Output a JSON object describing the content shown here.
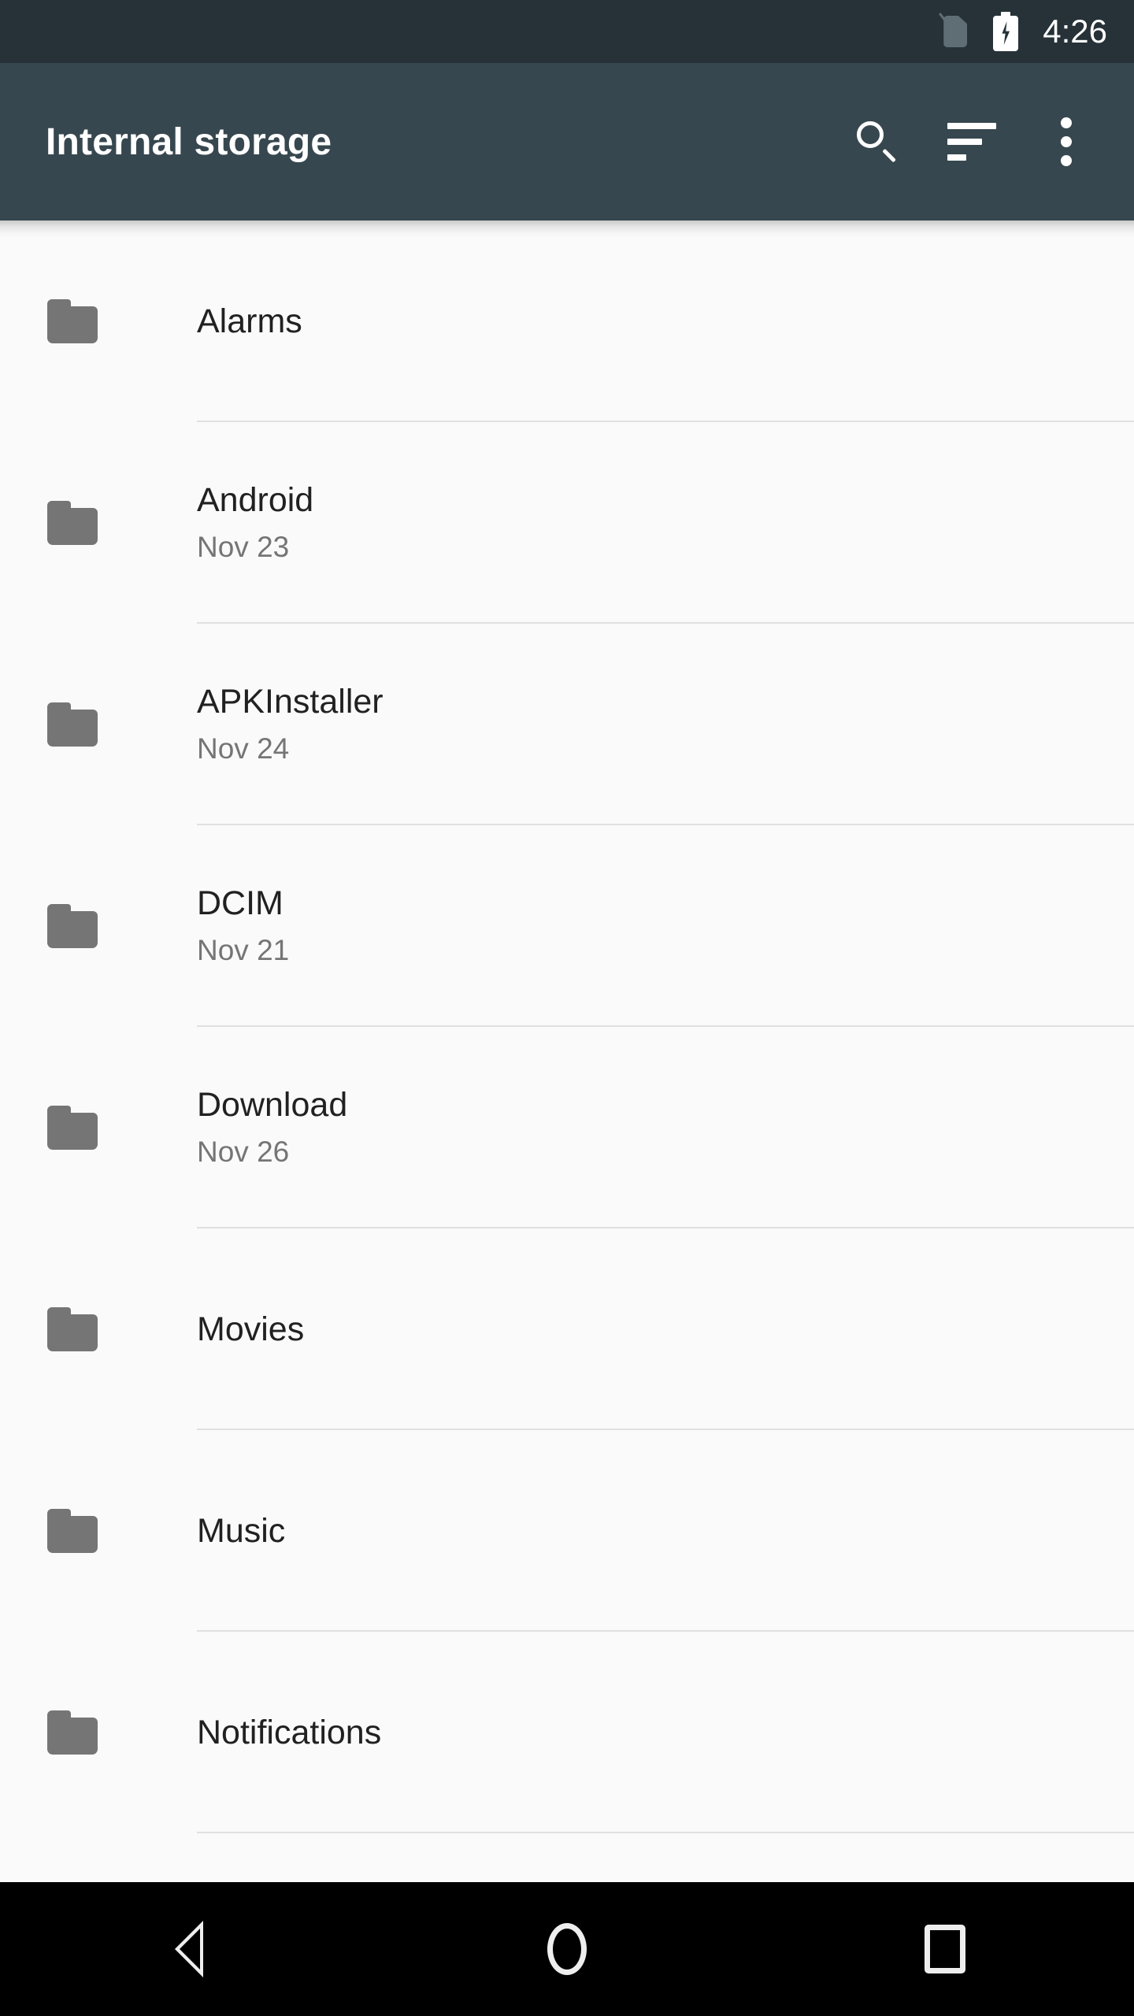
{
  "status_bar": {
    "sim_icon": "no-sim-icon",
    "battery_icon": "battery-charging-icon",
    "time": "4:26",
    "background_color": "#263238"
  },
  "app_bar": {
    "title": "Internal storage",
    "background_color": "#37474F",
    "actions": [
      {
        "name": "search",
        "icon": "search-icon"
      },
      {
        "name": "sort",
        "icon": "sort-icon"
      },
      {
        "name": "more-options",
        "icon": "overflow-menu-icon"
      }
    ]
  },
  "file_list": {
    "icon_name": "folder-icon",
    "icon_color": "#757575",
    "background_color": "#FAFAFA",
    "divider_color": "#E0E0E0",
    "items": [
      {
        "name": "Alarms",
        "modified": ""
      },
      {
        "name": "Android",
        "modified": "Nov 23"
      },
      {
        "name": "APKInstaller",
        "modified": "Nov 24"
      },
      {
        "name": "DCIM",
        "modified": "Nov 21"
      },
      {
        "name": "Download",
        "modified": "Nov 26"
      },
      {
        "name": "Movies",
        "modified": ""
      },
      {
        "name": "Music",
        "modified": ""
      },
      {
        "name": "Notifications",
        "modified": ""
      }
    ]
  },
  "nav_bar": {
    "background_color": "#000000",
    "buttons": [
      {
        "name": "back",
        "icon": "back-triangle-icon"
      },
      {
        "name": "home",
        "icon": "home-circle-icon"
      },
      {
        "name": "recents",
        "icon": "recents-square-icon"
      }
    ]
  }
}
